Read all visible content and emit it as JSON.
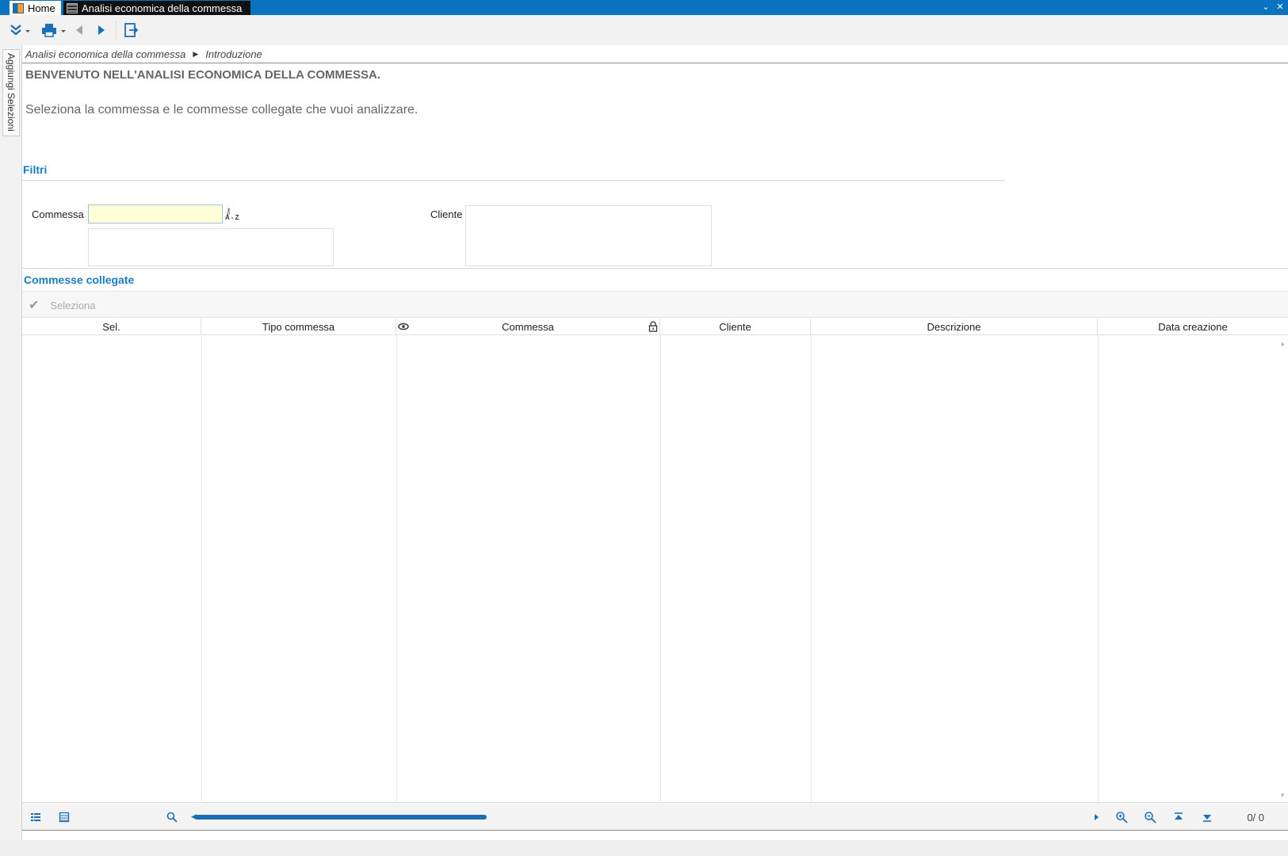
{
  "titlebar": {
    "home_tab": "Home",
    "active_tab": "Analisi economica della commessa",
    "minimize": "⌄",
    "close": "✕"
  },
  "toolbar": {
    "expand_icon": "double-chevron-down-icon",
    "print_icon": "printer-icon",
    "back_icon": "arrow-left-icon",
    "forward_icon": "arrow-right-icon",
    "exit_icon": "exit-icon"
  },
  "sidebar": {
    "tab_label": "Aggiungi Selezioni"
  },
  "breadcrumb": {
    "items": [
      "Analisi economica della commessa",
      "Introduzione"
    ]
  },
  "welcome": {
    "title": "BENVENUTO NELL'ANALISI ECONOMICA DELLA COMMESSA.",
    "subtitle": "Seleziona la commessa e le commesse collegate che vuoi analizzare."
  },
  "filters": {
    "title": "Filtri",
    "commessa_label": "Commessa",
    "commessa_value": "",
    "lookup_text": "A - Z",
    "cliente_label": "Cliente"
  },
  "linked": {
    "title": "Commesse collegate",
    "select_button": "Seleziona",
    "columns": [
      "Sel.",
      "Tipo commessa",
      "Commessa",
      "Cliente",
      "Descrizione",
      "Data creazione"
    ],
    "rows": []
  },
  "footer": {
    "counter": "0/   0"
  },
  "colors": {
    "accent": "#1a7dc4",
    "titlebar": "#0a73c0",
    "input_bg": "#ffffd8"
  }
}
